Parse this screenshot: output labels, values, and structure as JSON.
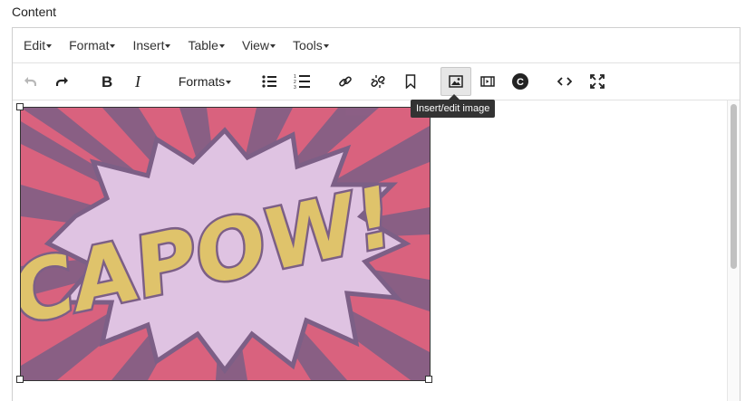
{
  "field": {
    "label": "Content"
  },
  "menubar": {
    "items": [
      {
        "label": "Edit"
      },
      {
        "label": "Format"
      },
      {
        "label": "Insert"
      },
      {
        "label": "Table"
      },
      {
        "label": "View"
      },
      {
        "label": "Tools"
      }
    ]
  },
  "toolbar": {
    "formats_label": "Formats",
    "buttons": [
      {
        "icon": "undo-icon",
        "state": "disabled"
      },
      {
        "icon": "redo-icon"
      },
      {
        "icon": "bold-icon"
      },
      {
        "icon": "italic-icon"
      },
      {
        "icon": "bullet-list-icon"
      },
      {
        "icon": "numbered-list-icon"
      },
      {
        "icon": "link-icon"
      },
      {
        "icon": "unlink-icon"
      },
      {
        "icon": "bookmark-icon"
      },
      {
        "icon": "image-icon",
        "state": "active"
      },
      {
        "icon": "media-icon"
      },
      {
        "icon": "copyright-icon"
      },
      {
        "icon": "code-icon"
      },
      {
        "icon": "fullscreen-icon"
      }
    ]
  },
  "tooltip": {
    "text": "Insert/edit image"
  },
  "content": {
    "image": {
      "text": "CAPOW!",
      "colors": {
        "background": "#d9627e",
        "burst": "#dfc3e2",
        "letters": "#dfc36b",
        "outline": "#7c5f86"
      }
    }
  }
}
